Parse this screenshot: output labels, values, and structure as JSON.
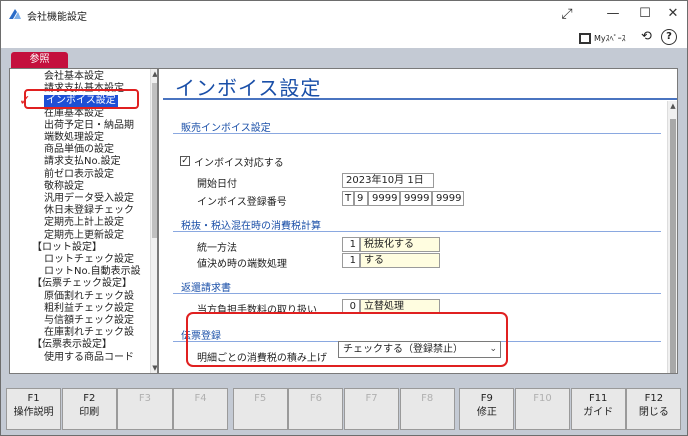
{
  "window": {
    "title": "会社機能設定",
    "minimize": "—",
    "maximize": "☐",
    "close": "✕",
    "expand": "⤢"
  },
  "toolbar": {
    "myspace_label": "Myｽﾍﾟｰｽ",
    "history_icon": "⟲",
    "help_icon": "?"
  },
  "tab": {
    "label": "参照"
  },
  "tree": [
    "会社基本設定",
    "請求支払基本設定",
    "インボイス設定",
    "在庫基本設定",
    "出荷予定日・納品期",
    "端数処理設定",
    "商品単価の設定",
    "請求支払No.設定",
    "前ゼロ表示設定",
    "敬称設定",
    "汎用データ受入設定",
    "休日未登録チェック",
    "定期売上計上設定",
    "定期売上更新設定",
    "【ロット設定】",
    "ロットチェック設定",
    "ロットNo.自動表示設",
    "【伝票チェック設定】",
    "原価割れチェック設",
    "粗利益チェック設定",
    "与信額チェック設定",
    "在庫割れチェック設",
    "【伝票表示設定】",
    "使用する商品コード"
  ],
  "page_title": "インボイス設定",
  "sections": {
    "sales_invoice": {
      "heading": "販売インボイス設定",
      "checkbox_label": "インボイス対応する",
      "checkbox_mark": "✓",
      "start_date_label": "開始日付",
      "start_date_value": "2023年10月 1日",
      "reg_no_label": "インボイス登録番号",
      "reg_no_parts": [
        "T",
        "9",
        "9999",
        "9999",
        "9999"
      ]
    },
    "tax_calc": {
      "heading": "税抜・税込混在時の消費税計算",
      "unify_label": "統一方法",
      "unify_code": "1",
      "unify_value": "税抜化する",
      "rounding_label": "値決め時の端数処理",
      "rounding_code": "1",
      "rounding_value": "する"
    },
    "return_bill": {
      "heading": "返還請求書",
      "fee_label": "当方負担手数料の取り扱い",
      "fee_code": "0",
      "fee_value": "立替処理"
    },
    "slip_reg": {
      "heading": "伝票登録",
      "tax_sum_label": "明細ごとの消費税の積み上げ",
      "tax_sum_value": "チェックする（登録禁止）"
    }
  },
  "fkeys": [
    {
      "key": "F1",
      "label": "操作説明",
      "enabled": true
    },
    {
      "key": "F2",
      "label": "印刷",
      "enabled": true
    },
    {
      "key": "F3",
      "label": "",
      "enabled": false
    },
    {
      "key": "F4",
      "label": "",
      "enabled": false
    },
    {
      "key": "F5",
      "label": "",
      "enabled": false
    },
    {
      "key": "F6",
      "label": "",
      "enabled": false
    },
    {
      "key": "F7",
      "label": "",
      "enabled": false
    },
    {
      "key": "F8",
      "label": "",
      "enabled": false
    },
    {
      "key": "F9",
      "label": "修正",
      "enabled": true
    },
    {
      "key": "F10",
      "label": "",
      "enabled": false
    },
    {
      "key": "F11",
      "label": "ガイド",
      "enabled": true
    },
    {
      "key": "F12",
      "label": "閉じる",
      "enabled": true
    }
  ],
  "colors": {
    "accent_blue": "#1a4fa8",
    "highlight_red": "#e02020",
    "tab_red": "#c4103d",
    "selection": "#1e4fd6",
    "frame_bg": "#c4cad4"
  }
}
